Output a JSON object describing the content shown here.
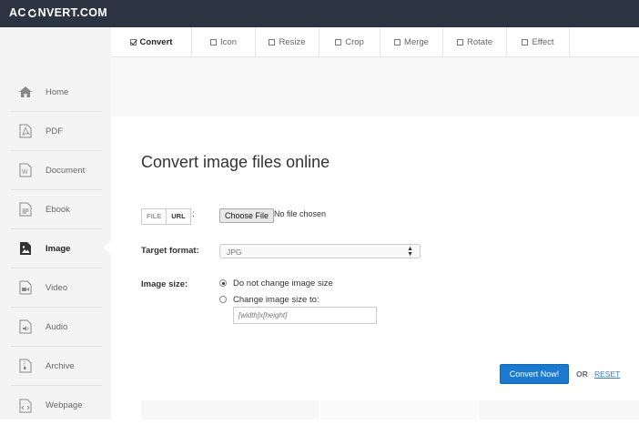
{
  "app": {
    "logo_left": "AC",
    "logo_right": "NVERT.COM"
  },
  "sidebar": {
    "items": [
      {
        "label": "Home",
        "icon": "home-icon"
      },
      {
        "label": "PDF",
        "icon": "pdf-icon"
      },
      {
        "label": "Document",
        "icon": "document-icon"
      },
      {
        "label": "Ebook",
        "icon": "ebook-icon"
      },
      {
        "label": "Image",
        "icon": "image-icon",
        "active": true
      },
      {
        "label": "Video",
        "icon": "video-icon"
      },
      {
        "label": "Audio",
        "icon": "audio-icon"
      },
      {
        "label": "Archive",
        "icon": "archive-icon"
      },
      {
        "label": "Webpage",
        "icon": "webpage-icon"
      }
    ]
  },
  "tabs": [
    {
      "label": "Convert",
      "checked": true
    },
    {
      "label": "Icon",
      "checked": false
    },
    {
      "label": "Resize",
      "checked": false
    },
    {
      "label": "Crop",
      "checked": false
    },
    {
      "label": "Merge",
      "checked": false
    },
    {
      "label": "Rotate",
      "checked": false
    },
    {
      "label": "Effect",
      "checked": false
    }
  ],
  "main": {
    "title": "Convert image files online",
    "source_toggle": {
      "file": "FILE",
      "url": "URL",
      "selected": "URL"
    },
    "colon": ":",
    "choose_file": "Choose File",
    "no_file": "No file chosen",
    "target_format_label": "Target format:",
    "target_format_value": "JPG",
    "image_size_label": "Image size:",
    "option_keep": "Do not change image size",
    "option_change": "Change image size to:",
    "size_placeholder": "[width]x[height]",
    "convert_button": "Convert Now!",
    "or_text": "OR",
    "reset_link": "RESET"
  },
  "colors": {
    "header": "#2b3440",
    "accent": "#1a7ad0",
    "link": "#3a7bc8"
  }
}
